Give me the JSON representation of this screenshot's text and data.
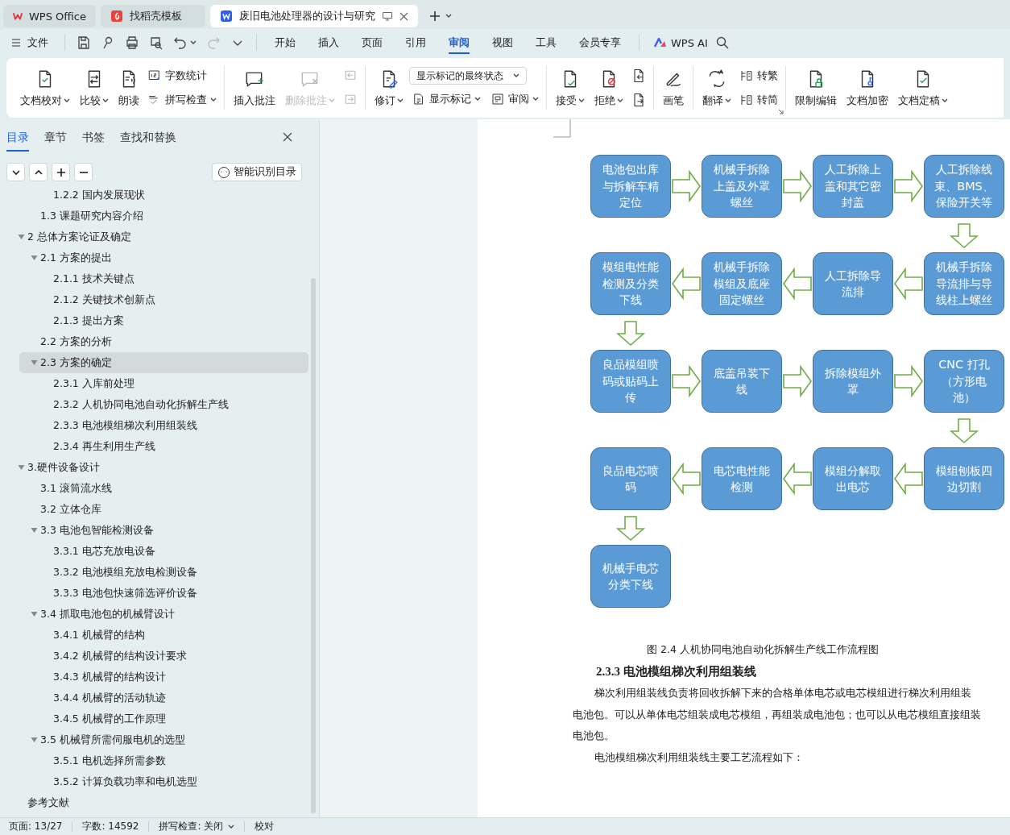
{
  "tabs": [
    {
      "label": "WPS Office",
      "kind": "home",
      "selected": false
    },
    {
      "label": "找稻壳模板",
      "kind": "template",
      "selected": false
    },
    {
      "label": "废旧电池处理器的设计与研究",
      "kind": "document",
      "selected": true
    }
  ],
  "menu": {
    "file": "文件",
    "tabs": [
      {
        "label": "开始",
        "selected": false
      },
      {
        "label": "插入",
        "selected": false
      },
      {
        "label": "页面",
        "selected": false
      },
      {
        "label": "引用",
        "selected": false
      },
      {
        "label": "审阅",
        "selected": true
      },
      {
        "label": "视图",
        "selected": false
      },
      {
        "label": "工具",
        "selected": false
      },
      {
        "label": "会员专享",
        "selected": false
      }
    ],
    "ai": "WPS AI"
  },
  "ribbon": {
    "groups": [
      {
        "launcher": false,
        "columns": [
          [
            [
              {
                "kind": "large",
                "label": "文档校对",
                "dropdown": true,
                "disabled": false
              }
            ]
          ],
          [
            [
              {
                "kind": "large",
                "label": "比较",
                "dropdown": true,
                "disabled": false
              }
            ]
          ],
          [
            [
              {
                "kind": "large",
                "label": "朗读",
                "dropdown": false,
                "disabled": false
              }
            ]
          ],
          [
            [
              {
                "kind": "small",
                "label": "字数统计",
                "dropdown": false,
                "disabled": false
              }
            ],
            [
              {
                "kind": "small",
                "label": "拼写检查",
                "dropdown": true,
                "disabled": false
              }
            ]
          ]
        ]
      },
      {
        "launcher": false,
        "columns": [
          [
            [
              {
                "kind": "large",
                "label": "插入批注",
                "dropdown": false,
                "disabled": false
              }
            ]
          ],
          [
            [
              {
                "kind": "large",
                "label": "删除批注",
                "dropdown": true,
                "disabled": true
              }
            ]
          ],
          [
            [
              {
                "kind": "icon",
                "dropdown": false,
                "disabled": true
              }
            ],
            [
              {
                "kind": "icon",
                "dropdown": false,
                "disabled": true
              }
            ]
          ]
        ]
      },
      {
        "launcher": false,
        "columns": [
          [
            [
              {
                "kind": "large",
                "label": "修订",
                "dropdown": true,
                "disabled": false
              }
            ]
          ],
          [
            [
              {
                "kind": "select",
                "label": "显示标记的最终状态",
                "dropdown": true,
                "disabled": false
              }
            ],
            [
              {
                "kind": "small",
                "label": "显示标记",
                "dropdown": true,
                "disabled": false
              },
              {
                "kind": "small",
                "label": "审阅",
                "dropdown": true,
                "disabled": false
              }
            ]
          ]
        ]
      },
      {
        "launcher": false,
        "columns": [
          [
            [
              {
                "kind": "large",
                "label": "接受",
                "dropdown": true,
                "disabled": false
              }
            ]
          ],
          [
            [
              {
                "kind": "large",
                "label": "拒绝",
                "dropdown": true,
                "disabled": false
              }
            ]
          ],
          [
            [
              {
                "kind": "icon",
                "dropdown": false,
                "disabled": false
              }
            ],
            [
              {
                "kind": "icon",
                "dropdown": false,
                "disabled": false
              }
            ]
          ]
        ]
      },
      {
        "launcher": false,
        "columns": [
          [
            [
              {
                "kind": "large",
                "label": "画笔",
                "dropdown": false,
                "disabled": false
              }
            ]
          ]
        ]
      },
      {
        "launcher": true,
        "columns": [
          [
            [
              {
                "kind": "large",
                "label": "翻译",
                "dropdown": true,
                "disabled": false
              }
            ]
          ],
          [
            [
              {
                "kind": "small",
                "label": "转繁",
                "dropdown": false,
                "disabled": false
              }
            ],
            [
              {
                "kind": "small",
                "label": "转简",
                "dropdown": false,
                "disabled": false
              }
            ]
          ]
        ]
      },
      {
        "launcher": false,
        "columns": [
          [
            [
              {
                "kind": "large",
                "label": "限制编辑",
                "dropdown": false,
                "disabled": false
              }
            ]
          ],
          [
            [
              {
                "kind": "large",
                "label": "文档加密",
                "dropdown": false,
                "disabled": false
              }
            ]
          ],
          [
            [
              {
                "kind": "large",
                "label": "文档定稿",
                "dropdown": true,
                "disabled": false
              }
            ]
          ]
        ]
      }
    ]
  },
  "sidebar": {
    "tabs": [
      {
        "label": "目录",
        "selected": true
      },
      {
        "label": "章节",
        "selected": false
      },
      {
        "label": "书签",
        "selected": false
      },
      {
        "label": "查找和替换",
        "selected": false
      }
    ],
    "smart_toc_button": "智能识别目录",
    "toc": [
      {
        "kind": "continued",
        "children": [
          {
            "kind": "continued",
            "children": [
              {
                "label": "1.2.2 国内发展现状",
                "selected": false
              }
            ]
          },
          {
            "label": "1.3  课题研究内容介绍",
            "selected": false
          }
        ]
      },
      {
        "label": "2  总体方案论证及确定",
        "selected": false,
        "expanded": true,
        "children": [
          {
            "label": "2.1 方案的提出",
            "selected": false,
            "expanded": true,
            "children": [
              {
                "label": "2.1.1 技术关键点",
                "selected": false
              },
              {
                "label": "2.1.2 关键技术创新点",
                "selected": false
              },
              {
                "label": "2.1.3 提出方案",
                "selected": false
              }
            ]
          },
          {
            "label": "2.2 方案的分析",
            "selected": false
          },
          {
            "label": "2.3 方案的确定",
            "selected": true,
            "expanded": true,
            "children": [
              {
                "label": "2.3.1 入库前处理",
                "selected": false
              },
              {
                "label": "2.3.2 人机协同电池自动化拆解生产线",
                "selected": false
              },
              {
                "label": "2.3.3 电池模组梯次利用组装线",
                "selected": false
              },
              {
                "label": "2.3.4 再生利用生产线",
                "selected": false
              }
            ]
          }
        ]
      },
      {
        "label": "3.硬件设备设计",
        "selected": false,
        "expanded": true,
        "children": [
          {
            "label": "3.1 滚筒流水线",
            "selected": false
          },
          {
            "label": "3.2 立体仓库",
            "selected": false
          },
          {
            "label": "3.3 电池包智能检测设备",
            "selected": false,
            "expanded": true,
            "children": [
              {
                "label": "3.3.1 电芯充放电设备",
                "selected": false
              },
              {
                "label": "3.3.2 电池模组充放电检测设备",
                "selected": false
              },
              {
                "label": "3.3.3 电池包快速筛选评价设备",
                "selected": false
              }
            ]
          },
          {
            "label": "3.4 抓取电池包的机械臂设计",
            "selected": false,
            "expanded": true,
            "children": [
              {
                "label": "3.4.1 机械臂的结构",
                "selected": false
              },
              {
                "label": "3.4.2 机械臂的结构设计要求",
                "selected": false
              },
              {
                "label": "3.4.3 机械臂的结构设计",
                "selected": false
              },
              {
                "label": "3.4.4 机械臂的活动轨迹",
                "selected": false
              },
              {
                "label": "3.4.5 机械臂的工作原理",
                "selected": false
              }
            ]
          },
          {
            "label": "3.5 机械臂所需伺服电机的选型",
            "selected": false,
            "expanded": true,
            "children": [
              {
                "label": "3.5.1 电机选择所需参数",
                "selected": false
              },
              {
                "label": "3.5.2 计算负载功率和电机选型",
                "selected": false
              }
            ]
          }
        ]
      },
      {
        "label": "参考文献",
        "selected": false
      }
    ]
  },
  "document": {
    "flowchart": {
      "rows": [
        {
          "reversed": false,
          "steps": [
            "电池包出库与拆解车精定位",
            "机械手拆除上盖及外罩螺丝",
            "人工拆除上盖和其它密封盖",
            "人工拆除线束、BMS、保险开关等"
          ]
        },
        {
          "reversed": true,
          "steps": [
            "模组电性能检测及分类下线",
            "机械手拆除模组及底座固定螺丝",
            "人工拆除导流排",
            "机械手拆除导流排与导线柱上螺丝"
          ]
        },
        {
          "reversed": false,
          "steps": [
            "良品模组喷码或贴码上传",
            "底盖吊装下线",
            "拆除模组外罩",
            "CNC 打孔（方形电池）"
          ]
        },
        {
          "reversed": true,
          "steps": [
            "良品电芯喷码",
            "电芯电性能检测",
            "模组分解取出电芯",
            "模组刨板四边切割"
          ]
        },
        {
          "steps": [
            "机械手电芯分类下线"
          ]
        }
      ]
    },
    "caption": "图 2.4 人机协同电池自动化拆解生产线工作流程图",
    "heading": "2.3.3 电池模组梯次利用组装线",
    "paragraphs": [
      {
        "lines": [
          "梯次利用组装线负责将回收拆解下来的合格单体电芯或电芯模组进行梯次利用组装",
          "电池包。可以从单体电芯组装成电芯模组，再组装成电池包；也可以从电芯模组直接组装",
          "电池包。"
        ]
      },
      {
        "lines": [
          "电池模组梯次利用组装线主要工艺流程如下："
        ]
      }
    ]
  },
  "status_bar": {
    "page": "页面: 13/27",
    "words": "字数: 14592",
    "spell_check": "拼写检查: 关闭",
    "proofread": "校对"
  }
}
